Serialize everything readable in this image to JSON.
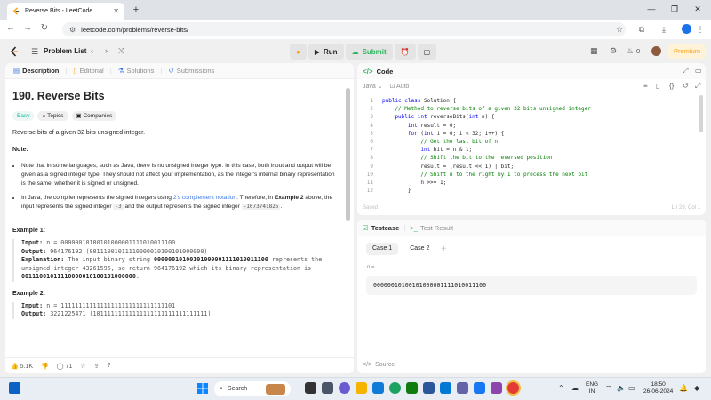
{
  "browser": {
    "tab_title": "Reverse Bits - LeetCode",
    "url": "leetcode.com/problems/reverse-bits/"
  },
  "header": {
    "problem_list": "Problem List",
    "run": "Run",
    "submit": "Submit",
    "streak_count": "0",
    "premium": "Premium"
  },
  "left_tabs": [
    {
      "label": "Description"
    },
    {
      "label": "Editorial"
    },
    {
      "label": "Solutions"
    },
    {
      "label": "Submissions"
    }
  ],
  "problem": {
    "title": "190. Reverse Bits",
    "difficulty": "Easy",
    "topics": "Topics",
    "companies": "Companies",
    "statement": "Reverse bits of a given 32 bits unsigned integer.",
    "note_label": "Note:",
    "note1": "Note that in some languages, such as Java, there is no unsigned integer type. In this case, both input and output will be given as a signed integer type. They should not affect your implementation, as the integer's internal binary representation is the same, whether it is signed or unsigned.",
    "note2_a": "In Java, the compiler represents the signed integers using ",
    "note2_link": "2's complement notation",
    "note2_b": ". Therefore, in ",
    "note2_bold": "Example 2",
    "note2_c": " above, the input represents the signed integer ",
    "note2_code1": "-3",
    "note2_d": " and the output represents the signed integer ",
    "note2_code2": "-1073741825",
    "note2_e": ".",
    "example1_title": "Example 1:",
    "ex1_input_label": "Input:",
    "ex1_input": " n = 00000010100101000001111010011100",
    "ex1_output_label": "Output:",
    "ex1_output": "    964176192 (00111001011110000010100101000000)",
    "ex1_expl_label": "Explanation:",
    "ex1_expl_a": " The input binary string ",
    "ex1_expl_b": "00000010100101000001111010011100",
    "ex1_expl_c": " represents the unsigned integer 43261596, so return 964176192 which its binary representation is ",
    "ex1_expl_d": "00111001011110000010100101000000",
    "ex1_expl_e": ".",
    "example2_title": "Example 2:",
    "ex2_input_label": "Input:",
    "ex2_input": " n = 11111111111111111111111111111101",
    "ex2_output_label": "Output:",
    "ex2_output": "   3221225471 (10111111111111111111111111111111)"
  },
  "footer": {
    "likes": "5.1K",
    "comments": "71"
  },
  "code_panel": {
    "title": "Code",
    "language": "Java",
    "auto": "Auto",
    "status": "Saved",
    "cursor": "Ln 29, Col 1",
    "lines": [
      {
        "n": "1",
        "segs": [
          {
            "t": "kw",
            "v": "public class "
          },
          {
            "t": "cd",
            "v": "Solution {"
          }
        ]
      },
      {
        "n": "2",
        "segs": [
          {
            "t": "cm",
            "v": "    // Method to reverse bits of a given 32 bits unsigned integer"
          }
        ]
      },
      {
        "n": "3",
        "segs": [
          {
            "t": "kw",
            "v": "    public int "
          },
          {
            "t": "cd",
            "v": "reverseBits("
          },
          {
            "t": "kw",
            "v": "int "
          },
          {
            "t": "cd",
            "v": "n) {"
          }
        ]
      },
      {
        "n": "4",
        "segs": [
          {
            "t": "kw",
            "v": "        int "
          },
          {
            "t": "cd",
            "v": "result = 0;"
          }
        ]
      },
      {
        "n": "5",
        "segs": [
          {
            "t": "kw",
            "v": "        for "
          },
          {
            "t": "cd",
            "v": "("
          },
          {
            "t": "kw",
            "v": "int "
          },
          {
            "t": "cd",
            "v": "i = 0; i < 32; i++) {"
          }
        ]
      },
      {
        "n": "6",
        "segs": [
          {
            "t": "cm",
            "v": "            // Get the last bit of n"
          }
        ]
      },
      {
        "n": "7",
        "segs": [
          {
            "t": "kw",
            "v": "            int "
          },
          {
            "t": "cd",
            "v": "bit = n & 1;"
          }
        ]
      },
      {
        "n": "8",
        "segs": [
          {
            "t": "cm",
            "v": "            // Shift the bit to the reversed position"
          }
        ]
      },
      {
        "n": "9",
        "segs": [
          {
            "t": "cd",
            "v": "            result = (result << 1) | bit;"
          }
        ]
      },
      {
        "n": "10",
        "segs": [
          {
            "t": "cm",
            "v": "            // Shift n to the right by 1 to process the next bit"
          }
        ]
      },
      {
        "n": "11",
        "segs": [
          {
            "t": "cd",
            "v": "            n >>= 1;"
          }
        ]
      },
      {
        "n": "12",
        "segs": [
          {
            "t": "cd",
            "v": "        }"
          }
        ]
      }
    ]
  },
  "testcase_panel": {
    "tab_testcase": "Testcase",
    "tab_result": "Test Result",
    "case1": "Case 1",
    "case2": "Case 2",
    "var_label": "n =",
    "var_value": "00000010100101000001111010011100",
    "source": "Source"
  },
  "taskbar": {
    "search": "Search",
    "lang_line1": "ENG",
    "lang_line2": "IN",
    "time": "18:50",
    "date": "26-06-2024"
  }
}
